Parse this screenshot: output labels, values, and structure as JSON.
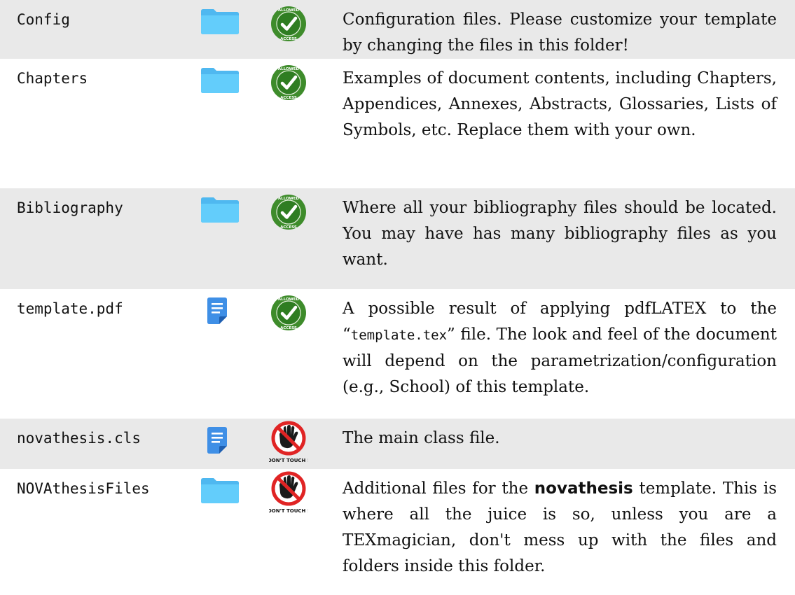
{
  "rows": [
    {
      "name": "Config",
      "type_icon": "folder-icon",
      "access_icon": "allowed-access-icon",
      "access_label": "ALLOWED ACCESS",
      "description": "Configuration files. Please customize your template by changing the files in this folder!"
    },
    {
      "name": "Chapters",
      "type_icon": "folder-icon",
      "access_icon": "allowed-access-icon",
      "access_label": "ALLOWED ACCESS",
      "description": "Examples of document contents, including Chapters, Appendices, Annexes, Abstracts, Glossaries, Lists of Symbols, etc. Replace them with your own."
    },
    {
      "name": "Bibliography",
      "type_icon": "folder-icon",
      "access_icon": "allowed-access-icon",
      "access_label": "ALLOWED ACCESS",
      "description": "Where all your bibliography files should be located. You may have has many bibliography files as you want."
    },
    {
      "name": "template.pdf",
      "type_icon": "document-icon",
      "access_icon": "allowed-access-icon",
      "access_label": "ALLOWED ACCESS",
      "description_pre": "A possible result of applying pdfLATEX to the “",
      "description_code": "template.tex",
      "description_post": "” file. The look and feel of the document will depend on the parametrization/configuration (e.g., School) of this template."
    },
    {
      "name": "novathesis.cls",
      "type_icon": "document-icon",
      "access_icon": "dont-touch-icon",
      "access_label": "DON'T TOUCH !",
      "description": "The main class file."
    },
    {
      "name": "NOVAthesisFiles",
      "type_icon": "folder-icon",
      "access_icon": "dont-touch-icon",
      "access_label": "DON'T TOUCH !",
      "description_pre": "Additional files for the ",
      "description_brand": "novathesis",
      "description_post": " template. This is where all the juice is so, unless you are a TEXmagician, don't mess up with the files and folders inside this folder."
    }
  ],
  "colors": {
    "row_shade": "#e9e9e9",
    "folder_blue": "#5ac8fa",
    "document_blue": "#4a90e2",
    "allowed_green": "#3d8a2c",
    "deny_red": "#e02424"
  }
}
